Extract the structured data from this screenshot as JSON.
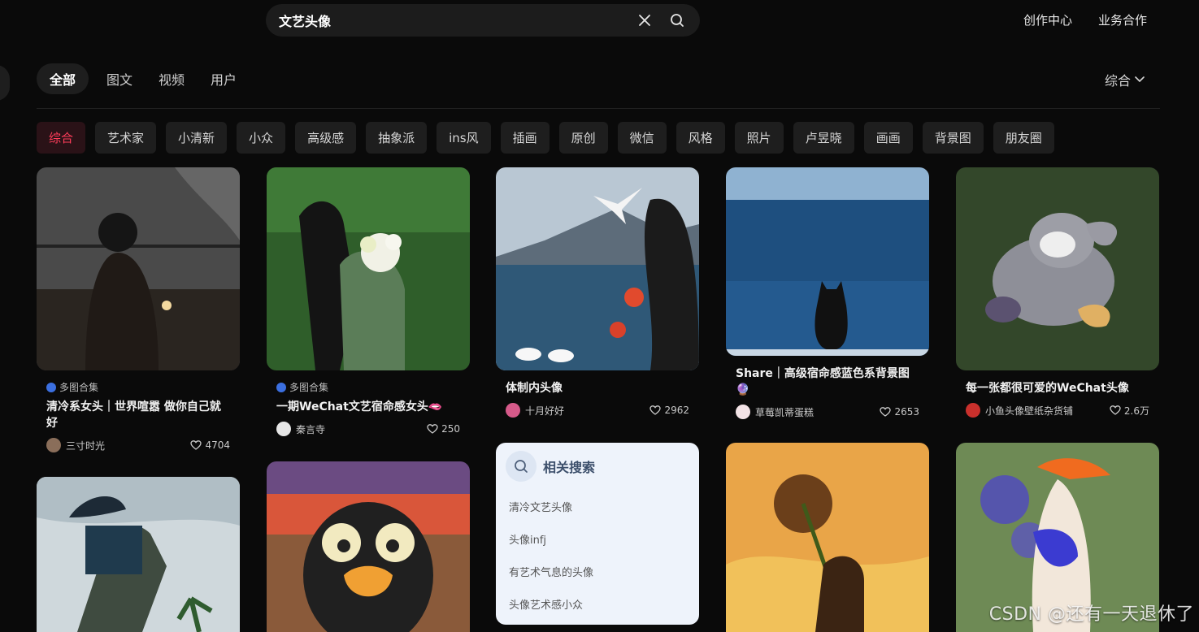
{
  "search": {
    "value": "文艺头像"
  },
  "top_links": [
    "创作中心",
    "业务合作"
  ],
  "tabs": [
    {
      "label": "全部",
      "active": true
    },
    {
      "label": "图文",
      "active": false
    },
    {
      "label": "视频",
      "active": false
    },
    {
      "label": "用户",
      "active": false
    }
  ],
  "sort": {
    "label": "综合"
  },
  "chips": [
    "综合",
    "艺术家",
    "小清新",
    "小众",
    "高级感",
    "抽象派",
    "ins风",
    "插画",
    "原创",
    "微信",
    "风格",
    "照片",
    "卢昱晓",
    "画画",
    "背景图",
    "朋友圈"
  ],
  "cards": [
    {
      "badge": "多图合集",
      "title": "清冷系女头｜世界喧嚣 做你自己就好",
      "author": "三寸时光",
      "likes": "4704",
      "accent": "#3b3b3b"
    },
    {
      "badge": "多图合集",
      "title": "一期WeChat文艺宿命感女头🫦",
      "author": "秦言寺",
      "likes": "250",
      "accent": "#3f6b35"
    },
    {
      "badge": "",
      "title": "体制内头像",
      "author": "十月好好",
      "likes": "2962",
      "accent": "#3e6a8f"
    },
    {
      "badge": "",
      "title": "Share｜高级宿命感蓝色系背景图🔮",
      "author": "草莓凯蒂蛋糕",
      "likes": "2653",
      "accent": "#1f4f7f"
    },
    {
      "badge": "",
      "title": "每一张都很可爱的WeChat头像",
      "author": "小鱼头像壁纸杂货铺",
      "likes": "2.6万",
      "accent": "#3d5a2a"
    }
  ],
  "related": {
    "title": "相关搜索",
    "items": [
      "清冷文艺头像",
      "头像infj",
      "有艺术气息的头像",
      "头像艺术感小众"
    ]
  },
  "watermark": "CSDN @还有一天退休了"
}
